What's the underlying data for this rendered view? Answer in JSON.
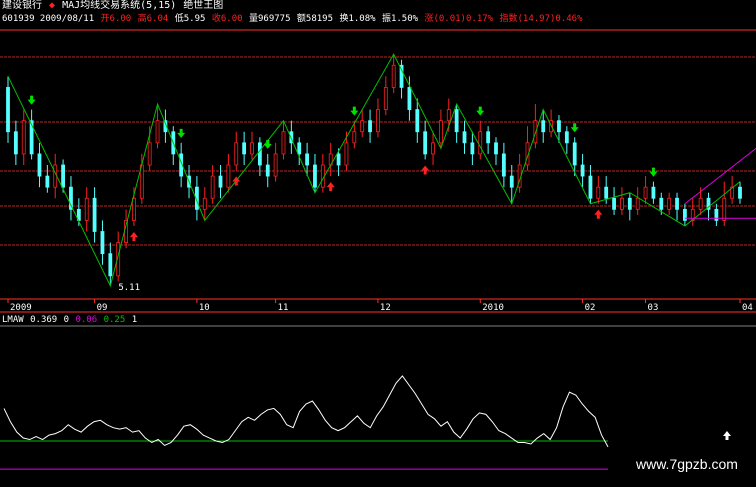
{
  "header": {
    "stock_name": "建设银行",
    "indicator_title": "MAJ均线交易系统(5,15)",
    "chart_title": "绝世王图",
    "code_date": "601939 2009/08/11",
    "open": "开6.00",
    "high": "高6.04",
    "low": "低5.95",
    "close": "收6.00",
    "volume": "量969775",
    "amount": "额58195",
    "turnover": "换1.08%",
    "amplitude": "振1.50%",
    "change": "涨(0.01)0.17%",
    "index": "指数(14.97)0.46%"
  },
  "sub_header": {
    "name": "LMAW",
    "v1": "0.369",
    "v2": "0",
    "v3": "0.06",
    "v4": "0.25",
    "v5": "1"
  },
  "watermark": "www.7gpzb.com",
  "colors": {
    "up": "#ff2020",
    "down": "#54ffff",
    "zigzag": "#00c000",
    "arrow_up": "#ff2020",
    "arrow_down": "#00e000",
    "hline": "#ff3030",
    "osc": "#ffffff",
    "level_green": "#00c000",
    "level_magenta": "#e000e0"
  },
  "chart_data": [
    {
      "type": "candlestick",
      "x_ticks": [
        "2009",
        "09",
        "10",
        "11",
        "12",
        "2010",
        "02",
        "03",
        "04"
      ],
      "annotation": "5.11",
      "ylim": [
        5.0,
        7.4
      ],
      "candles": [
        [
          6.9,
          6.5,
          7.0,
          6.4
        ],
        [
          6.5,
          6.3,
          6.6,
          6.2
        ],
        [
          6.3,
          6.6,
          6.7,
          6.2
        ],
        [
          6.6,
          6.3,
          6.7,
          6.25
        ],
        [
          6.3,
          6.1,
          6.4,
          6.0
        ],
        [
          6.1,
          6.0,
          6.2,
          5.95
        ],
        [
          6.0,
          6.2,
          6.3,
          5.9
        ],
        [
          6.2,
          6.0,
          6.25,
          5.95
        ],
        [
          6.0,
          5.8,
          6.1,
          5.7
        ],
        [
          5.8,
          5.7,
          5.9,
          5.65
        ],
        [
          5.7,
          5.9,
          6.0,
          5.6
        ],
        [
          5.9,
          5.6,
          6.0,
          5.5
        ],
        [
          5.6,
          5.4,
          5.7,
          5.3
        ],
        [
          5.4,
          5.2,
          5.5,
          5.11
        ],
        [
          5.2,
          5.5,
          5.6,
          5.15
        ],
        [
          5.5,
          5.7,
          5.8,
          5.45
        ],
        [
          5.7,
          5.9,
          6.0,
          5.65
        ],
        [
          5.9,
          6.2,
          6.3,
          5.85
        ],
        [
          6.2,
          6.4,
          6.55,
          6.15
        ],
        [
          6.4,
          6.6,
          6.75,
          6.35
        ],
        [
          6.6,
          6.5,
          6.7,
          6.4
        ],
        [
          6.5,
          6.3,
          6.55,
          6.2
        ],
        [
          6.3,
          6.1,
          6.4,
          6.0
        ],
        [
          6.1,
          6.0,
          6.2,
          5.9
        ],
        [
          6.0,
          5.8,
          6.1,
          5.7
        ],
        [
          5.8,
          5.9,
          6.0,
          5.7
        ],
        [
          5.9,
          6.1,
          6.2,
          5.85
        ],
        [
          6.1,
          6.0,
          6.2,
          5.9
        ],
        [
          6.0,
          6.2,
          6.3,
          5.95
        ],
        [
          6.2,
          6.4,
          6.5,
          6.15
        ],
        [
          6.4,
          6.3,
          6.5,
          6.2
        ],
        [
          6.3,
          6.4,
          6.5,
          6.25
        ],
        [
          6.4,
          6.2,
          6.45,
          6.1
        ],
        [
          6.2,
          6.1,
          6.3,
          6.0
        ],
        [
          6.1,
          6.3,
          6.4,
          6.05
        ],
        [
          6.3,
          6.5,
          6.6,
          6.25
        ],
        [
          6.5,
          6.4,
          6.6,
          6.3
        ],
        [
          6.4,
          6.3,
          6.45,
          6.2
        ],
        [
          6.3,
          6.2,
          6.4,
          6.1
        ],
        [
          6.2,
          6.0,
          6.3,
          5.95
        ],
        [
          6.0,
          6.2,
          6.3,
          5.95
        ],
        [
          6.2,
          6.3,
          6.4,
          6.1
        ],
        [
          6.3,
          6.2,
          6.35,
          6.1
        ],
        [
          6.2,
          6.4,
          6.5,
          6.15
        ],
        [
          6.4,
          6.5,
          6.6,
          6.35
        ],
        [
          6.5,
          6.6,
          6.7,
          6.45
        ],
        [
          6.6,
          6.5,
          6.7,
          6.4
        ],
        [
          6.5,
          6.7,
          6.8,
          6.45
        ],
        [
          6.7,
          6.9,
          7.0,
          6.65
        ],
        [
          6.9,
          7.1,
          7.2,
          6.85
        ],
        [
          7.1,
          6.9,
          7.15,
          6.8
        ],
        [
          6.9,
          6.7,
          7.0,
          6.6
        ],
        [
          6.7,
          6.5,
          6.8,
          6.4
        ],
        [
          6.5,
          6.3,
          6.6,
          6.25
        ],
        [
          6.3,
          6.4,
          6.5,
          6.2
        ],
        [
          6.4,
          6.6,
          6.7,
          6.35
        ],
        [
          6.6,
          6.7,
          6.8,
          6.5
        ],
        [
          6.7,
          6.5,
          6.75,
          6.4
        ],
        [
          6.5,
          6.4,
          6.6,
          6.3
        ],
        [
          6.4,
          6.3,
          6.5,
          6.2
        ],
        [
          6.3,
          6.5,
          6.6,
          6.25
        ],
        [
          6.5,
          6.4,
          6.55,
          6.3
        ],
        [
          6.4,
          6.3,
          6.45,
          6.2
        ],
        [
          6.3,
          6.1,
          6.4,
          6.0
        ],
        [
          6.1,
          6.0,
          6.2,
          5.85
        ],
        [
          6.0,
          6.2,
          6.3,
          5.95
        ],
        [
          6.2,
          6.4,
          6.55,
          6.15
        ],
        [
          6.4,
          6.6,
          6.75,
          6.35
        ],
        [
          6.6,
          6.5,
          6.7,
          6.4
        ],
        [
          6.5,
          6.6,
          6.7,
          6.45
        ],
        [
          6.6,
          6.5,
          6.65,
          6.4
        ],
        [
          6.5,
          6.4,
          6.55,
          6.3
        ],
        [
          6.4,
          6.2,
          6.45,
          6.1
        ],
        [
          6.2,
          6.1,
          6.3,
          6.0
        ],
        [
          6.1,
          5.9,
          6.2,
          5.85
        ],
        [
          5.9,
          6.0,
          6.1,
          5.85
        ],
        [
          6.0,
          5.9,
          6.1,
          5.85
        ],
        [
          5.9,
          5.8,
          6.0,
          5.75
        ],
        [
          5.8,
          5.9,
          6.0,
          5.75
        ],
        [
          5.9,
          5.8,
          5.95,
          5.7
        ],
        [
          5.8,
          5.9,
          6.0,
          5.75
        ],
        [
          5.9,
          6.0,
          6.1,
          5.85
        ],
        [
          6.0,
          5.9,
          6.05,
          5.85
        ],
        [
          5.9,
          5.8,
          5.95,
          5.75
        ],
        [
          5.8,
          5.9,
          5.95,
          5.75
        ],
        [
          5.9,
          5.8,
          5.95,
          5.7
        ],
        [
          5.8,
          5.7,
          5.85,
          5.65
        ],
        [
          5.7,
          5.8,
          5.9,
          5.65
        ],
        [
          5.8,
          5.9,
          6.0,
          5.75
        ],
        [
          5.9,
          5.8,
          5.95,
          5.7
        ],
        [
          5.8,
          5.7,
          5.85,
          5.65
        ],
        [
          5.7,
          5.9,
          6.05,
          5.65
        ],
        [
          5.9,
          6.0,
          6.1,
          5.85
        ],
        [
          6.0,
          5.9,
          6.05,
          5.85
        ]
      ]
    },
    {
      "type": "line",
      "name": "LMAW",
      "ylim": [
        0,
        1
      ],
      "levels": [
        0.25,
        0.06
      ],
      "values": [
        0.47,
        0.38,
        0.31,
        0.27,
        0.26,
        0.28,
        0.26,
        0.29,
        0.3,
        0.32,
        0.36,
        0.33,
        0.31,
        0.35,
        0.38,
        0.39,
        0.36,
        0.34,
        0.33,
        0.34,
        0.31,
        0.32,
        0.27,
        0.24,
        0.26,
        0.22,
        0.24,
        0.29,
        0.35,
        0.36,
        0.33,
        0.29,
        0.27,
        0.25,
        0.24,
        0.26,
        0.32,
        0.38,
        0.41,
        0.39,
        0.43,
        0.46,
        0.47,
        0.43,
        0.36,
        0.34,
        0.45,
        0.5,
        0.52,
        0.46,
        0.39,
        0.34,
        0.32,
        0.34,
        0.38,
        0.42,
        0.37,
        0.34,
        0.42,
        0.48,
        0.56,
        0.64,
        0.69,
        0.63,
        0.57,
        0.5,
        0.43,
        0.4,
        0.35,
        0.38,
        0.31,
        0.27,
        0.33,
        0.4,
        0.44,
        0.43,
        0.38,
        0.32,
        0.3,
        0.27,
        0.24,
        0.24,
        0.23,
        0.27,
        0.3,
        0.26,
        0.34,
        0.48,
        0.58,
        0.56,
        0.5,
        0.45,
        0.41,
        0.29,
        0.21
      ]
    }
  ]
}
